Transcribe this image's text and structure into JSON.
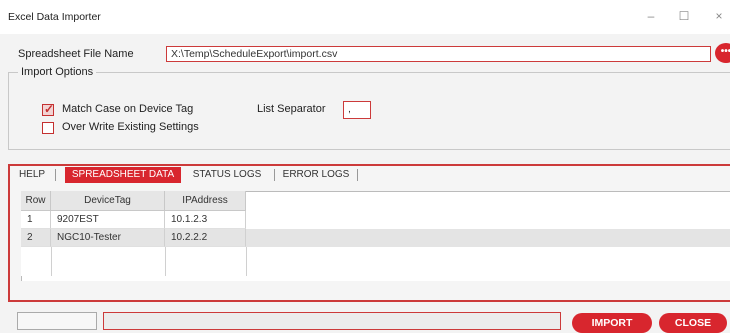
{
  "window": {
    "title": "Excel Data Importer",
    "minimize": "–",
    "maximize": "☐",
    "close": "×"
  },
  "file": {
    "label": "Spreadsheet File Name",
    "value": "X:\\Temp\\ScheduleExport\\import.csv",
    "browse_icon": "more-dots-icon",
    "browse_glyph": "•••"
  },
  "import_options": {
    "legend": "Import Options",
    "match_case": {
      "label": "Match Case on Device Tag",
      "checked": true
    },
    "overwrite": {
      "label": "Over Write Existing Settings",
      "checked": false
    },
    "list_separator": {
      "label": "List Separator",
      "value": ","
    }
  },
  "tabs": [
    {
      "label": "HELP",
      "active": false
    },
    {
      "label": "SPREADSHEET DATA",
      "active": true
    },
    {
      "label": "STATUS LOGS",
      "active": false
    },
    {
      "label": "ERROR LOGS",
      "active": false
    }
  ],
  "table": {
    "columns": [
      "Row",
      "DeviceTag",
      "IPAddress"
    ],
    "rows": [
      [
        "1",
        "9207EST",
        "10.1.2.3"
      ],
      [
        "2",
        "NGC10-Tester",
        "10.2.2.2"
      ]
    ]
  },
  "footer": {
    "import_label": "IMPORT",
    "close_label": "CLOSE"
  },
  "colors": {
    "accent": "#d8262e"
  }
}
